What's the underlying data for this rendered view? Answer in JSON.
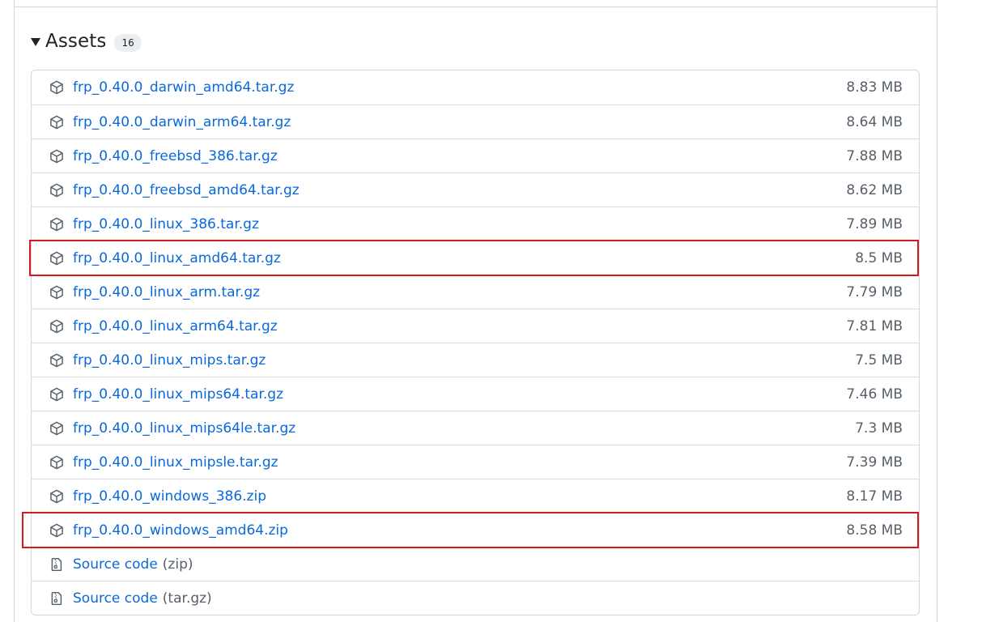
{
  "assets": {
    "title": "Assets",
    "count": "16",
    "files": [
      {
        "name": "frp_0.40.0_darwin_amd64.tar.gz",
        "size": "8.83 MB",
        "highlighted": false
      },
      {
        "name": "frp_0.40.0_darwin_arm64.tar.gz",
        "size": "8.64 MB",
        "highlighted": false
      },
      {
        "name": "frp_0.40.0_freebsd_386.tar.gz",
        "size": "7.88 MB",
        "highlighted": false
      },
      {
        "name": "frp_0.40.0_freebsd_amd64.tar.gz",
        "size": "8.62 MB",
        "highlighted": false
      },
      {
        "name": "frp_0.40.0_linux_386.tar.gz",
        "size": "7.89 MB",
        "highlighted": false
      },
      {
        "name": "frp_0.40.0_linux_amd64.tar.gz",
        "size": "8.5 MB",
        "highlighted": true
      },
      {
        "name": "frp_0.40.0_linux_arm.tar.gz",
        "size": "7.79 MB",
        "highlighted": false
      },
      {
        "name": "frp_0.40.0_linux_arm64.tar.gz",
        "size": "7.81 MB",
        "highlighted": false
      },
      {
        "name": "frp_0.40.0_linux_mips.tar.gz",
        "size": "7.5 MB",
        "highlighted": false
      },
      {
        "name": "frp_0.40.0_linux_mips64.tar.gz",
        "size": "7.46 MB",
        "highlighted": false
      },
      {
        "name": "frp_0.40.0_linux_mips64le.tar.gz",
        "size": "7.3 MB",
        "highlighted": false
      },
      {
        "name": "frp_0.40.0_linux_mipsle.tar.gz",
        "size": "7.39 MB",
        "highlighted": false
      },
      {
        "name": "frp_0.40.0_windows_386.zip",
        "size": "8.17 MB",
        "highlighted": false
      },
      {
        "name": "frp_0.40.0_windows_amd64.zip",
        "size": "8.58 MB",
        "highlighted": true
      }
    ],
    "source_code": [
      {
        "label": "Source code",
        "format": "(zip)"
      },
      {
        "label": "Source code",
        "format": "(tar.gz)"
      }
    ]
  },
  "icons": {
    "package": "package-icon",
    "file_zip": "file-zip-icon",
    "caret": "triangle-down-icon"
  },
  "colors": {
    "link": "#0969da",
    "muted": "#57606a",
    "highlight": "#d7191c",
    "border": "#d0d7de"
  }
}
